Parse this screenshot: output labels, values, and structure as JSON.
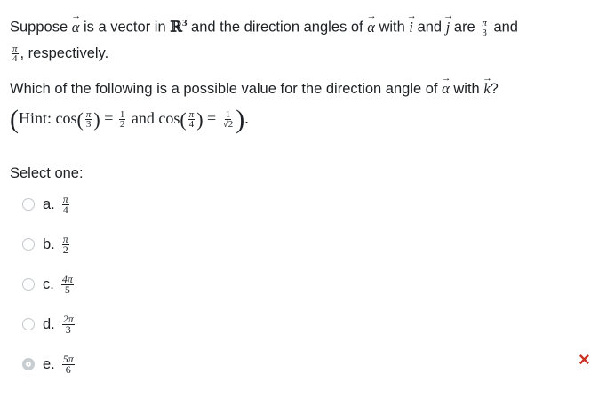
{
  "question": {
    "suppose": "Suppose",
    "vec_alpha": "α",
    "is_a_vector_in": "is a vector in",
    "space_R": "ℝ",
    "space_exp": "3",
    "direction_angles_text": "and the direction angles of",
    "with": "with",
    "vec_i": "i",
    "and": "and",
    "vec_j": "j",
    "are": "are",
    "angle1": {
      "num": "π",
      "den": "3"
    },
    "and2": "and",
    "angle2": {
      "num": "π",
      "den": "4"
    },
    "respectively": ", respectively.",
    "line2": "Which of the following is a possible value for the direction angle of",
    "with_k": "with",
    "vec_k": "k",
    "qmark": "?"
  },
  "hint": {
    "open_paren": "(",
    "hint_label": "Hint: ",
    "cos1": "cos",
    "cos1_arg": {
      "num": "π",
      "den": "3"
    },
    "eq1": " = ",
    "val1": {
      "num": "1",
      "den": "2"
    },
    "and_text": " and ",
    "cos2": "cos",
    "cos2_arg": {
      "num": "π",
      "den": "4"
    },
    "eq2": " = ",
    "val2": {
      "num": "1",
      "den": "√2"
    },
    "close_paren": ")",
    "period": "."
  },
  "select_one": "Select one:",
  "options": [
    {
      "label": "a.",
      "num": "π",
      "den": "4",
      "checked": false
    },
    {
      "label": "b.",
      "num": "π",
      "den": "2",
      "checked": false
    },
    {
      "label": "c.",
      "num": "4π",
      "den": "5",
      "checked": false
    },
    {
      "label": "d.",
      "num": "2π",
      "den": "3",
      "checked": false
    },
    {
      "label": "e.",
      "num": "5π",
      "den": "6",
      "checked": true
    }
  ],
  "feedback": {
    "incorrect_icon": "×",
    "color": "#ca3120"
  }
}
